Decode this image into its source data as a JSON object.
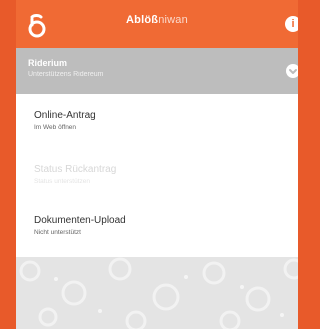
{
  "app_bar": {
    "title_main": "Ablöß",
    "title_rest": "niwan",
    "info_glyph": "i",
    "logo_icon": "b-logo"
  },
  "context": {
    "title": "Riderium",
    "subtitle": "Unterstützens Ridereum"
  },
  "list": [
    {
      "title": "Online-Antrag",
      "subtitle": "Im Web öffnen",
      "muted": false
    },
    {
      "title": "Status Rückantrag",
      "subtitle": "Status unterstützen",
      "muted": true
    },
    {
      "title": "Dokumenten-Upload",
      "subtitle": "Nicht unterstützt",
      "muted": false
    }
  ],
  "colors": {
    "accent": "#f06a34",
    "border": "#e85a2a",
    "context_bg": "#bdbdbd",
    "pattern_bg": "#e4e4e4"
  }
}
